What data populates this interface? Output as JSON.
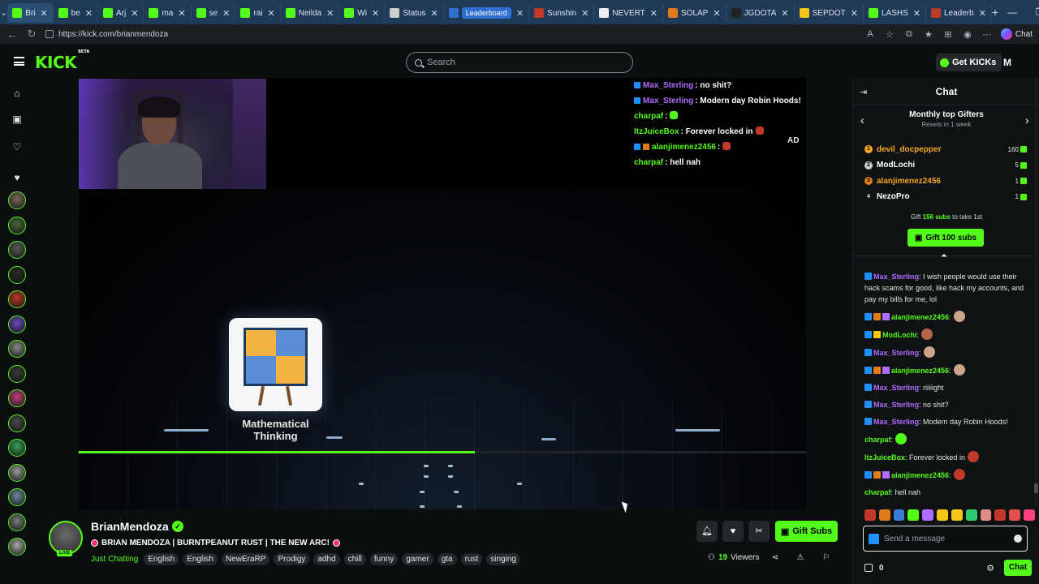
{
  "browser": {
    "tabs": [
      {
        "label": "Bri",
        "fav": "#53fc18",
        "active": true
      },
      {
        "label": "be",
        "fav": "#53fc18"
      },
      {
        "label": "Arj",
        "fav": "#53fc18"
      },
      {
        "label": "ma",
        "fav": "#53fc18"
      },
      {
        "label": "se",
        "fav": "#53fc18"
      },
      {
        "label": "rai",
        "fav": "#53fc18"
      },
      {
        "label": "Neilda",
        "fav": "#53fc18"
      },
      {
        "label": "Wi",
        "fav": "#53fc18"
      },
      {
        "label": "Status",
        "fav": "#cccccc"
      },
      {
        "label": "Leaderboard",
        "fav": "#2f6fd1",
        "pill": true
      },
      {
        "label": "Sunshin",
        "fav": "#c0392b"
      },
      {
        "label": "NEVERT",
        "fav": "#eeeeee"
      },
      {
        "label": "SOLAP",
        "fav": "#e07b1a"
      },
      {
        "label": "JGDOTA",
        "fav": "#222222"
      },
      {
        "label": "SEPDOT",
        "fav": "#f5c518"
      },
      {
        "label": "LASHS",
        "fav": "#53fc18"
      },
      {
        "label": "Leaderb",
        "fav": "#c0392b"
      }
    ],
    "url": "https://kick.com/brianmendoza",
    "copilot_label": "Chat"
  },
  "header": {
    "logo_text": "KICK",
    "logo_beta": "BETA",
    "search_placeholder": "Search",
    "get_kicks_label": "Get KICKs",
    "user_initial": "M"
  },
  "player": {
    "graphic_title": "Mathematical Thinking",
    "ad_label": "AD",
    "progress_fraction": 0.545,
    "overlay_chat": [
      {
        "user": "Max_Sterling",
        "color": "#b06cff",
        "badges": [
          "blue"
        ],
        "text": ": no shit?"
      },
      {
        "user": "Max_Sterling",
        "color": "#b06cff",
        "badges": [
          "blue"
        ],
        "text": ": Modern day Robin Hoods!"
      },
      {
        "user": "charpaf",
        "color": "#53fc18",
        "badges": [],
        "text": ":",
        "emote": "#53fc18"
      },
      {
        "user": "ItzJuiceBox",
        "color": "#53fc18",
        "badges": [],
        "text": ": Forever locked in",
        "emote": "#c0392b"
      },
      {
        "user": "alanjimenez2456",
        "color": "#53fc18",
        "badges": [
          "blue",
          "orange"
        ],
        "text": ":",
        "emote": "#c0392b"
      },
      {
        "user": "charpaf",
        "color": "#53fc18",
        "badges": [],
        "text": ": hell nah"
      }
    ]
  },
  "stream": {
    "streamer": "BrianMendoza",
    "live_label": "LIVE",
    "title": "BRIAN MENDOZA | BURNTPEANUT RUST | THE NEW ARC!",
    "category": "Just Chatting",
    "tags": [
      "English",
      "English",
      "NewEraRP",
      "Prodigy",
      "adhd",
      "chill",
      "funny",
      "gamer",
      "gta",
      "rust",
      "singing"
    ],
    "viewers_count": "19",
    "viewers_label": "Viewers",
    "gift_subs_label": "Gift Subs"
  },
  "chat": {
    "title": "Chat",
    "gifters_title": "Monthly top Gifters",
    "gifters_sub": "Resets in 1 week",
    "gifters": [
      {
        "rank": "1",
        "name": "devil_docpepper",
        "count": "160",
        "color": "#f5a623",
        "rank_color": "#f5a623"
      },
      {
        "rank": "2",
        "name": "ModLochi",
        "count": "5",
        "color": "#ffffff",
        "rank_color": "#c7cdd1"
      },
      {
        "rank": "3",
        "name": "alanjimenez2456",
        "count": "1",
        "color": "#f5a623",
        "rank_color": "#e07b1a"
      },
      {
        "rank": "4",
        "name": "NezoPro",
        "count": "1",
        "color": "#ffffff",
        "rank_color": "transparent"
      }
    ],
    "gift_cta_prefix": "Gift",
    "gift_cta_amount": "156 subs",
    "gift_cta_suffix": "to take 1st",
    "gift_button": "Gift 100 subs",
    "messages": [
      {
        "user": "Max_Sterling",
        "color": "#b06cff",
        "badges": [
          "#1e90ff"
        ],
        "text": ": I wish people would use their hack scams for good, like hack my accounts, and pay my bills for me, lol"
      },
      {
        "user": "alanjimenez2456",
        "color": "#53fc18",
        "badges": [
          "#1e90ff",
          "#e07b1a",
          "#b06cff"
        ],
        "text": ":",
        "emote": "#caa58a"
      },
      {
        "user": "ModLochi",
        "color": "#53fc18",
        "badges": [
          "#1e90ff",
          "#f5c518"
        ],
        "text": ":",
        "emote": "#b5654a"
      },
      {
        "user": "Max_Sterling",
        "color": "#b06cff",
        "badges": [
          "#1e90ff"
        ],
        "text": ":",
        "emote": "#caa58a"
      },
      {
        "user": "alanjimenez2456",
        "color": "#53fc18",
        "badges": [
          "#1e90ff",
          "#e07b1a",
          "#b06cff"
        ],
        "text": ":",
        "emote": "#caa58a"
      },
      {
        "user": "Max_Sterling",
        "color": "#b06cff",
        "badges": [
          "#1e90ff"
        ],
        "text": ": riiiiight"
      },
      {
        "user": "Max_Sterling",
        "color": "#b06cff",
        "badges": [
          "#1e90ff"
        ],
        "text": ": no shit?"
      },
      {
        "user": "Max_Sterling",
        "color": "#b06cff",
        "badges": [
          "#1e90ff"
        ],
        "text": ": Modern day Robin Hoods!"
      },
      {
        "user": "charpaf",
        "color": "#53fc18",
        "badges": [],
        "text": ":",
        "emote": "#53fc18"
      },
      {
        "user": "ItzJuiceBox",
        "color": "#53fc18",
        "badges": [],
        "text": ": Forever locked in",
        "emote": "#c0392b"
      },
      {
        "user": "alanjimenez2456",
        "color": "#53fc18",
        "badges": [
          "#1e90ff",
          "#e07b1a",
          "#b06cff"
        ],
        "text": ":",
        "emote": "#c0392b"
      },
      {
        "user": "charpaf",
        "color": "#53fc18",
        "badges": [],
        "text": ": hell nah"
      }
    ],
    "emote_strip": [
      "#c0392b",
      "#e07b1a",
      "#3a7bd5",
      "#53fc18",
      "#b06cff",
      "#f5c518",
      "#f5c518",
      "#2ecc71",
      "#e08a8a",
      "#c0392b",
      "#e05050",
      "#ff4081"
    ],
    "input_placeholder": "Send a message",
    "points": "0",
    "send_label": "Chat"
  },
  "rail": {
    "avatars": [
      "#7a6a5a",
      "#4a6a3a",
      "#5a5a5a",
      "#2a2a2a",
      "#c0392b",
      "#6a4ac0",
      "#8a8a8a",
      "#3a3a3a",
      "#c04080",
      "#4a4a4a",
      "#3aa05a",
      "#9a9a9a",
      "#6a8a9a",
      "#7a7a7a",
      "#aaaaaa"
    ]
  }
}
